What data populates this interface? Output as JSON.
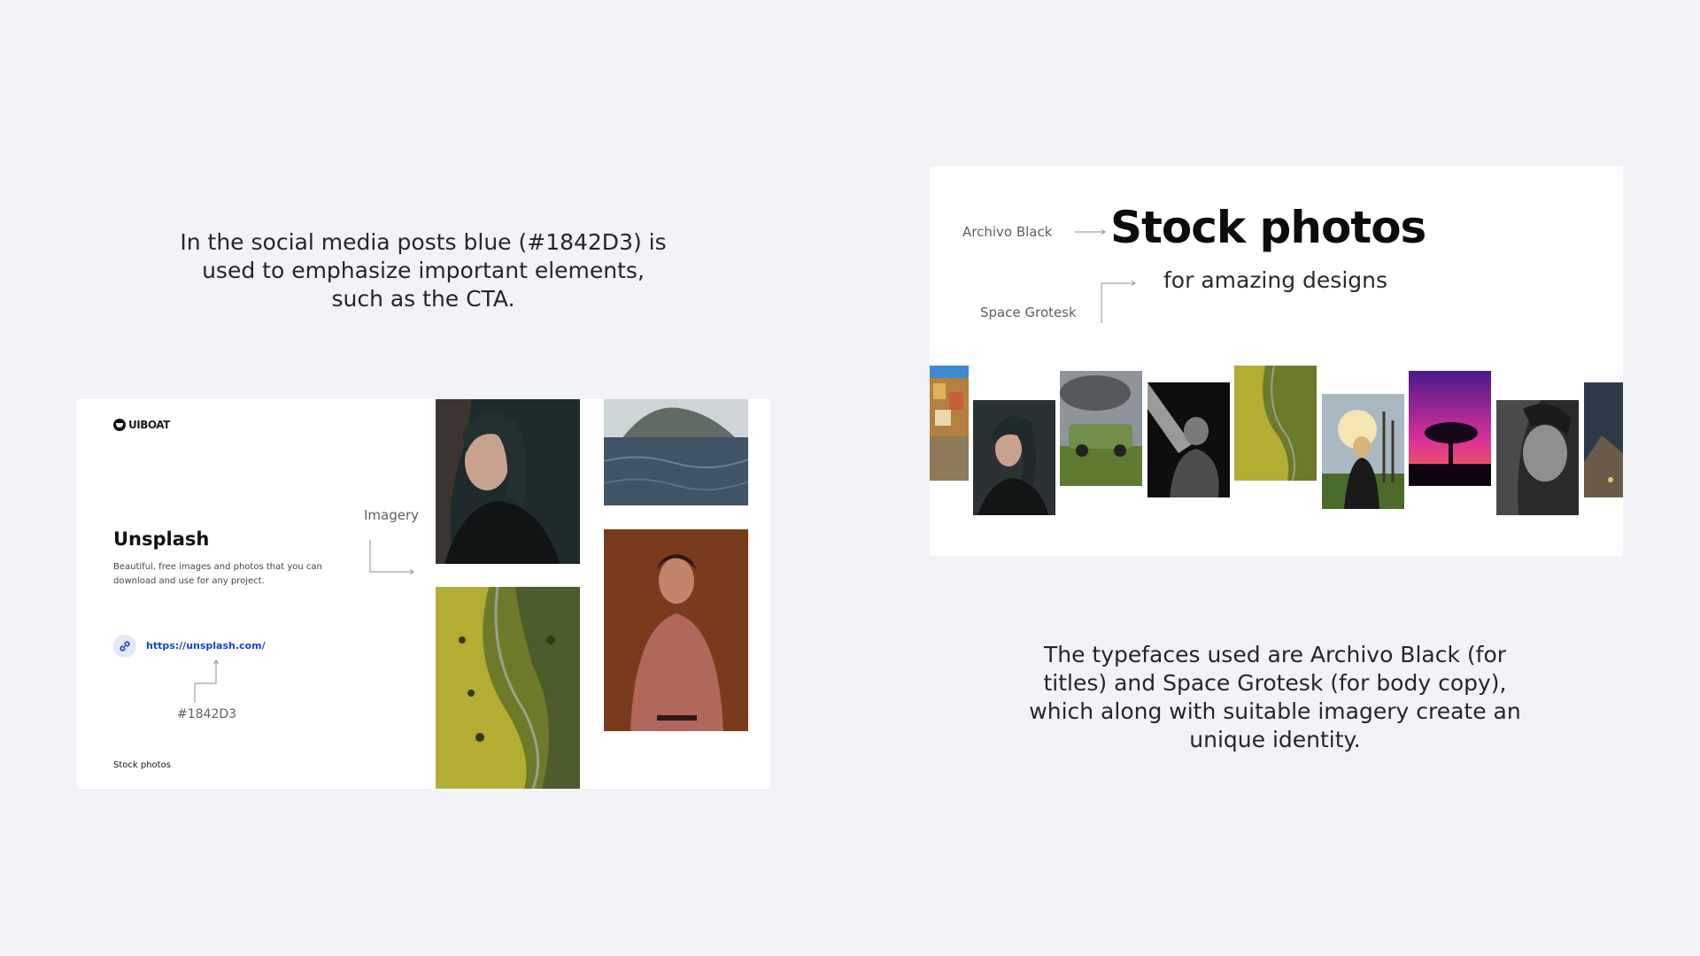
{
  "captions": {
    "left": "In the social media posts blue (#1842D3) is used to emphasize important elements, such as the CTA.",
    "right": "The typefaces used are Archivo Black (for titles) and Space Grotesk (for body copy), which along with suitable imagery create an unique identity."
  },
  "left_card": {
    "logo_text": "UIBOAT",
    "title": "Unsplash",
    "description": "Beautiful, free images and photos that you can download and use for any project.",
    "link": "https://unsplash.com/",
    "link_icon": "link-icon",
    "color_label": "#1842D3",
    "imagery_label": "Imagery",
    "footer_label": "Stock photos"
  },
  "right_card": {
    "title": "Stock photos",
    "subtitle": "for amazing designs",
    "font_title_label": "Archivo Black",
    "font_body_label": "Space Grotesk"
  },
  "colors": {
    "accent": "#1842D3",
    "background": "#f2f3f6",
    "card": "#ffffff"
  }
}
